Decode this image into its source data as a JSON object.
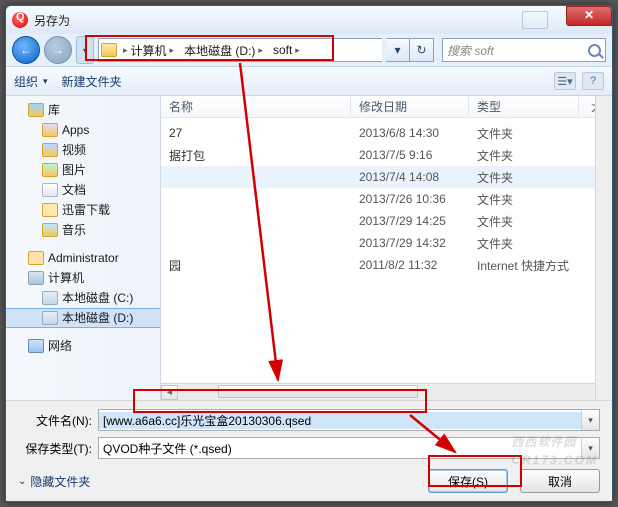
{
  "window": {
    "title": "另存为"
  },
  "breadcrumb": {
    "segments": [
      "计算机",
      "本地磁盘 (D:)",
      "soft"
    ],
    "search_placeholder": "搜索 soft"
  },
  "toolbar": {
    "organize": "组织",
    "new_folder": "新建文件夹"
  },
  "sidebar": {
    "library": "库",
    "items": [
      {
        "label": "Apps",
        "icon": "apps"
      },
      {
        "label": "视频",
        "icon": "vid"
      },
      {
        "label": "图片",
        "icon": "pic"
      },
      {
        "label": "文档",
        "icon": "doc"
      },
      {
        "label": "迅雷下载",
        "icon": "folder"
      },
      {
        "label": "音乐",
        "icon": "music"
      }
    ],
    "admin": "Administrator",
    "computer": "计算机",
    "drives": [
      {
        "label": "本地磁盘 (C:)"
      },
      {
        "label": "本地磁盘 (D:)",
        "selected": true
      }
    ],
    "network": "网络"
  },
  "columns": {
    "name": "名称",
    "date": "修改日期",
    "type": "类型",
    "size": "大小"
  },
  "rows": [
    {
      "name": "27",
      "date": "2013/6/8 14:30",
      "type": "文件夹"
    },
    {
      "name": "据打包",
      "date": "2013/7/5 9:16",
      "type": "文件夹"
    },
    {
      "name": "",
      "date": "2013/7/4 14:08",
      "type": "文件夹",
      "hover": true
    },
    {
      "name": "",
      "date": "2013/7/26 10:36",
      "type": "文件夹"
    },
    {
      "name": "",
      "date": "2013/7/29 14:25",
      "type": "文件夹"
    },
    {
      "name": "",
      "date": "2013/7/29 14:32",
      "type": "文件夹"
    },
    {
      "name": "园",
      "date": "2011/8/2 11:32",
      "type": "Internet 快捷方式"
    }
  ],
  "form": {
    "filename_label": "文件名(N):",
    "filename_value": "[www.a6a6.cc]乐光宝盒20130306.qsed",
    "filetype_label": "保存类型(T):",
    "filetype_value": "QVOD种子文件 (*.qsed)"
  },
  "footer": {
    "hide_folders": "隐藏文件夹",
    "save": "保存(S)",
    "cancel": "取消"
  },
  "watermark": {
    "line1": "西西软件园",
    "line2": "CR173.COM"
  }
}
